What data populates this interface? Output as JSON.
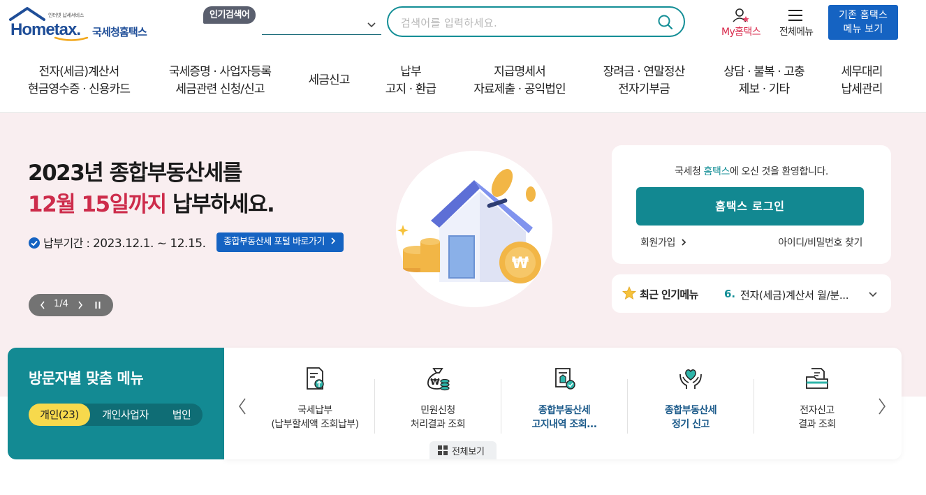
{
  "logo": {
    "small_text": "인터넷 납세서비스",
    "brand": "Hometax",
    "brand_suffix": ".",
    "korean_name": "국세청홈택스"
  },
  "header": {
    "popular_label": "인기검색어",
    "search_placeholder": "검색어를 입력하세요.",
    "my_hometax": "My홈택스",
    "all_menu": "전체메뉴",
    "old_menu_line1": "기존 홈택스",
    "old_menu_line2": "메뉴 보기"
  },
  "gnb": [
    {
      "line1": "전자(세금)계산서",
      "line2": "현금영수증 · 신용카드"
    },
    {
      "line1": "국세증명 · 사업자등록",
      "line2": "세금관련 신청/신고"
    },
    {
      "line1": "세금신고",
      "line2": ""
    },
    {
      "line1": "납부",
      "line2": "고지 · 환급"
    },
    {
      "line1": "지급명세서",
      "line2": "자료제출 · 공익법인"
    },
    {
      "line1": "장려금 · 연말정산",
      "line2": "전자기부금"
    },
    {
      "line1": "상담 · 불복 · 고충",
      "line2": "제보 · 기타"
    },
    {
      "line1": "세무대리",
      "line2": "납세관리"
    }
  ],
  "banner": {
    "title_line1": "2023년 종합부동산세를",
    "title_red": "12월 15일까지",
    "title_rest": " 납부하세요.",
    "period_label": "납부기간 : ",
    "period_dates": "2023.12.1. ~ 12.15.",
    "portal_link": "종합부동산세 포털 바로가기",
    "pager": "1/4"
  },
  "login": {
    "welcome_pre": "국세청 ",
    "welcome_hl": "홈택스",
    "welcome_post": "에 오신 것을 환영합니다.",
    "login_button": "홈택스 로그인",
    "join": "회원가입",
    "find_id": "아이디/비밀번호 찾기"
  },
  "popular_menu": {
    "title": "최근 인기메뉴",
    "rank": "6.",
    "item": "전자(세금)계산서 월/분..."
  },
  "visitor": {
    "title": "방문자별 맞춤 메뉴",
    "tabs": [
      "개인(23)",
      "개인사업자",
      "법인"
    ],
    "cards": [
      {
        "line1": "국세납부",
        "line2": "(납부할세액 조회납부)",
        "icon": "tax-payment-icon"
      },
      {
        "line1": "민원신청",
        "line2": "처리결과 조회",
        "icon": "money-bag-icon"
      },
      {
        "line1": "종합부동산세",
        "line2": "고지내역 조회...",
        "icon": "notice-doc-icon"
      },
      {
        "line1": "종합부동산세",
        "line2": "정기 신고",
        "icon": "heart-hands-icon"
      },
      {
        "line1": "전자신고",
        "line2": "결과 조회",
        "icon": "folder-doc-icon"
      }
    ],
    "view_all": "전체보기"
  },
  "colors": {
    "accent_teal": "#138a93",
    "brand_blue": "#1563c2",
    "banner_pink": "#f9eef0",
    "highlight_red": "#cd2c4b",
    "tab_yellow": "#f7d94c"
  }
}
